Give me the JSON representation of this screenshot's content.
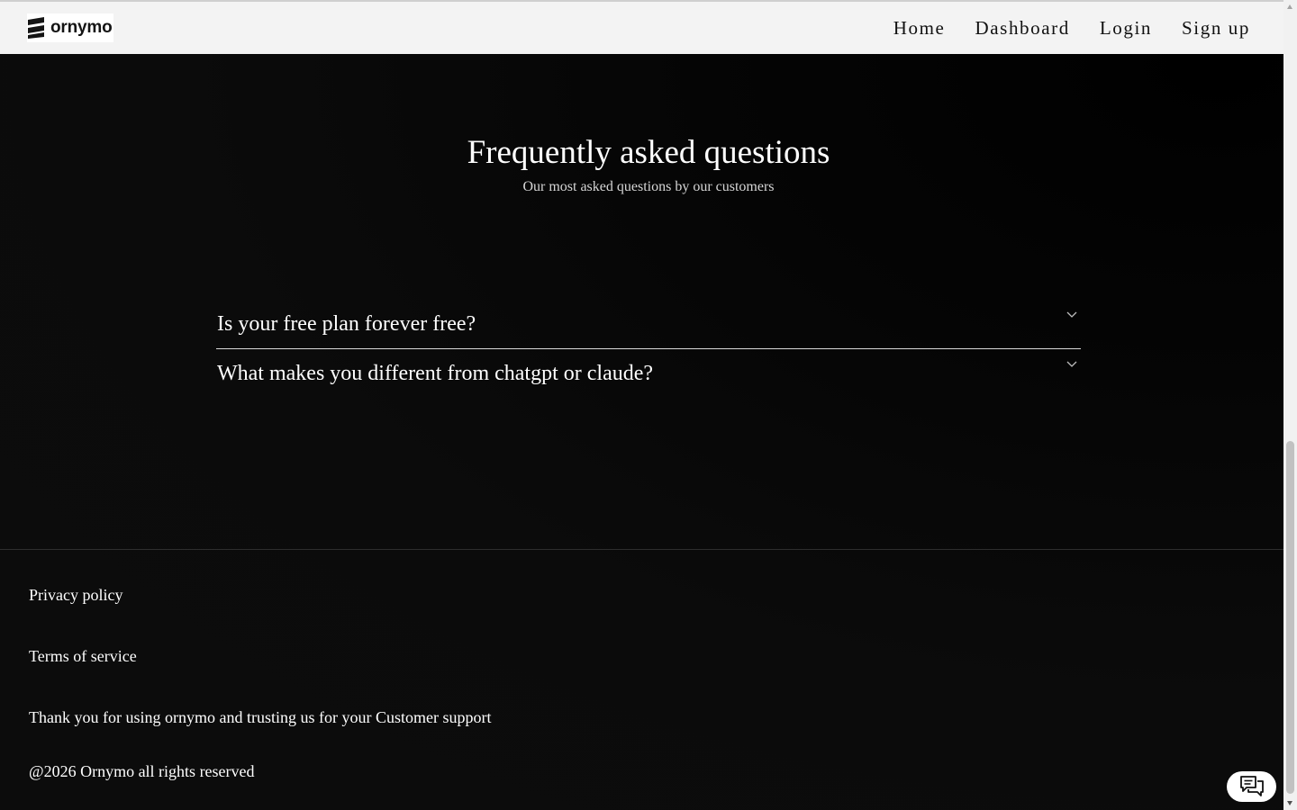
{
  "brand": {
    "name": "ornymo"
  },
  "nav": {
    "items": [
      {
        "label": "Home"
      },
      {
        "label": "Dashboard"
      },
      {
        "label": "Login"
      },
      {
        "label": "Sign up"
      }
    ]
  },
  "faq": {
    "title": "Frequently asked questions",
    "subtitle": "Our most asked questions by our customers",
    "items": [
      {
        "question": "Is your free plan forever free?",
        "icon": "chevron-down-icon"
      },
      {
        "question": "What makes you different from chatgpt or claude?",
        "icon": "chevron-down-icon"
      }
    ]
  },
  "footer": {
    "privacy": "Privacy policy",
    "terms": "Terms of service",
    "thanks": "Thank you for using ornymo and trusting us for your Customer support",
    "copyright": "@2026 Ornymo all rights reserved"
  },
  "chat": {
    "icon": "chat-bubbles-icon"
  },
  "colors": {
    "background": "#0a0a0a",
    "navbar": "#f3f3f3",
    "text": "#ffffff"
  }
}
